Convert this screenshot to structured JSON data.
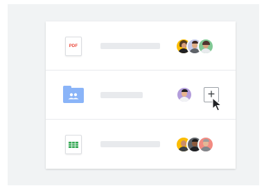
{
  "files": [
    {
      "type_label": "PDF",
      "icon": "pdf-file-icon",
      "shared_with": [
        "person-avatar-woman-smiling",
        "person-avatar-man",
        "person-avatar-woman"
      ]
    },
    {
      "icon": "shared-folder-icon",
      "shared_with": [
        "person-avatar-man-glasses"
      ],
      "add_button_label": "+"
    },
    {
      "icon": "spreadsheet-file-icon",
      "shared_with": [
        "person-avatar-man-bald",
        "person-avatar-man-dark",
        "person-avatar-man-old"
      ]
    }
  ],
  "colors": {
    "pdf_red": "#ea4335",
    "folder_blue": "#8ab4f8",
    "sheets_green": "#34a853"
  }
}
